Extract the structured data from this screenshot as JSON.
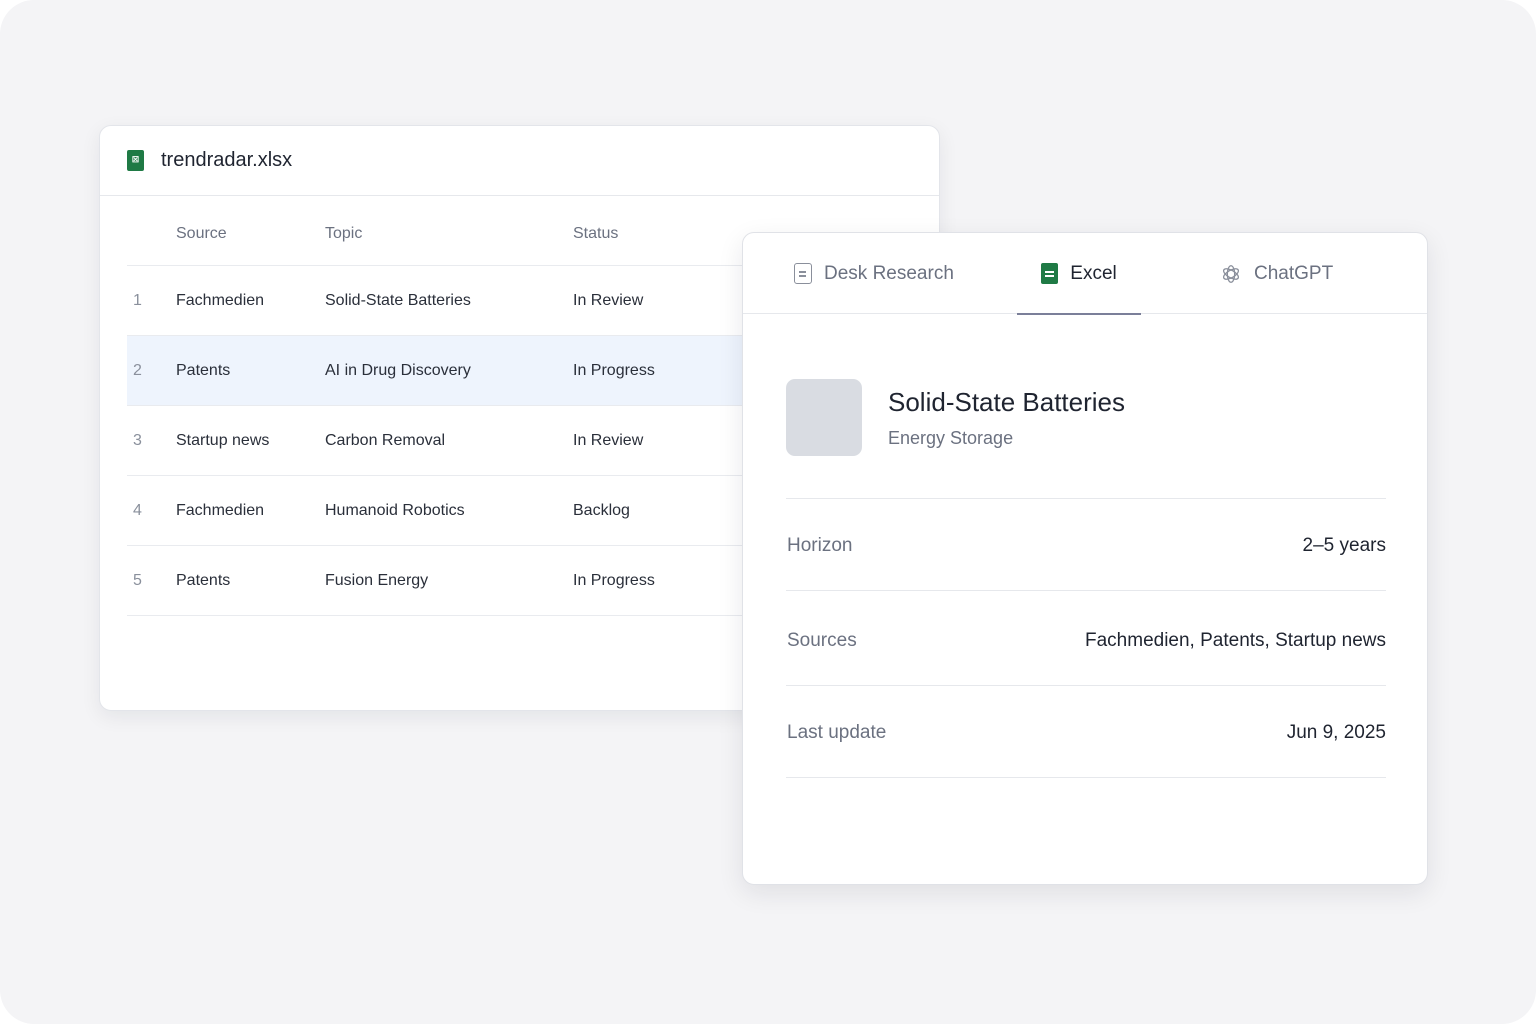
{
  "spreadsheet": {
    "filename": "trendradar.xlsx",
    "icon": "spreadsheet-file-icon",
    "columns": {
      "source": "Source",
      "topic": "Topic",
      "status": "Status"
    },
    "rows": [
      {
        "num": "1",
        "source": "Fachmedien",
        "topic": "Solid-State Batteries",
        "status": "In Review"
      },
      {
        "num": "2",
        "source": "Patents",
        "topic": "AI in Drug Discovery",
        "status": "In Progress"
      },
      {
        "num": "3",
        "source": "Startup news",
        "topic": "Carbon Removal",
        "status": "In Review"
      },
      {
        "num": "4",
        "source": "Fachmedien",
        "topic": "Humanoid Robotics",
        "status": "Backlog"
      },
      {
        "num": "5",
        "source": "Patents",
        "topic": "Fusion Energy",
        "status": "In Progress"
      }
    ],
    "selected_row": 2,
    "colors": {
      "selected_row_bg": "#eef4fd",
      "excel_green": "#1f7a45"
    }
  },
  "detail": {
    "tabs": [
      {
        "label": "Desk Research",
        "icon": "document-icon",
        "active": false
      },
      {
        "label": "Excel",
        "icon": "excel-sheet-icon",
        "active": true
      },
      {
        "label": "ChatGPT",
        "icon": "chatgpt-icon",
        "active": false
      }
    ],
    "topic": {
      "title": "Solid-State Batteries",
      "subtitle": "Energy Storage"
    },
    "fields": {
      "horizon": {
        "label": "Horizon",
        "value": "2–5 years"
      },
      "sources": {
        "label": "Sources",
        "value": "Fachmedien, Patents, Startup news"
      },
      "last_update": {
        "label": "Last update",
        "value": "Jun 9, 2025"
      }
    }
  }
}
